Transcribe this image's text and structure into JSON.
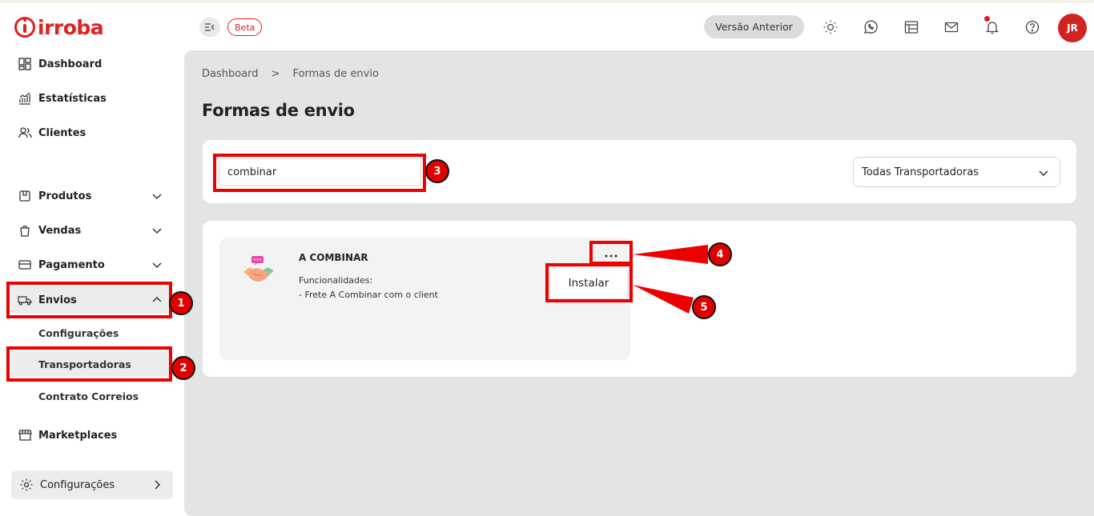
{
  "brand": {
    "name": "irroba",
    "color": "#e02020"
  },
  "sidebar": {
    "items": [
      {
        "label": "Dashboard",
        "icon": "dashboard-icon"
      },
      {
        "label": "Estatísticas",
        "icon": "chart-icon"
      },
      {
        "label": "Clientes",
        "icon": "users-icon"
      },
      {
        "label": "Produtos",
        "icon": "box-icon"
      },
      {
        "label": "Vendas",
        "icon": "bag-icon"
      },
      {
        "label": "Pagamento",
        "icon": "card-icon"
      },
      {
        "label": "Envios",
        "icon": "truck-icon",
        "expanded": true
      },
      {
        "label": "Marketplaces",
        "icon": "store-icon"
      }
    ],
    "envios_sub": [
      {
        "label": "Configurações"
      },
      {
        "label": "Transportadoras",
        "active": true
      },
      {
        "label": "Contrato Correios"
      }
    ],
    "bottom": {
      "label": "Configurações",
      "icon": "settings-icon"
    }
  },
  "header": {
    "beta_label": "Beta",
    "prev_version_label": "Versão Anterior",
    "icons": [
      "sun-icon",
      "whatsapp-icon",
      "layout-icon",
      "mail-icon",
      "bell-icon",
      "help-icon"
    ],
    "avatar_initials": "JR"
  },
  "breadcrumb": {
    "items": [
      "Dashboard",
      "Formas de envio"
    ],
    "separator": ">"
  },
  "page": {
    "title": "Formas de envio"
  },
  "filters": {
    "search_value": "combinar",
    "carrier_select": "Todas Transportadoras"
  },
  "shipping_methods": [
    {
      "title": "A COMBINAR",
      "features_label": "Funcionalidades:",
      "feature": "- Frete A Combinar com o client",
      "more_label": "...",
      "menu_action": "Instalar"
    }
  ],
  "annotations": {
    "badges": [
      "1",
      "2",
      "3",
      "4",
      "5"
    ],
    "color": "#e00000"
  }
}
